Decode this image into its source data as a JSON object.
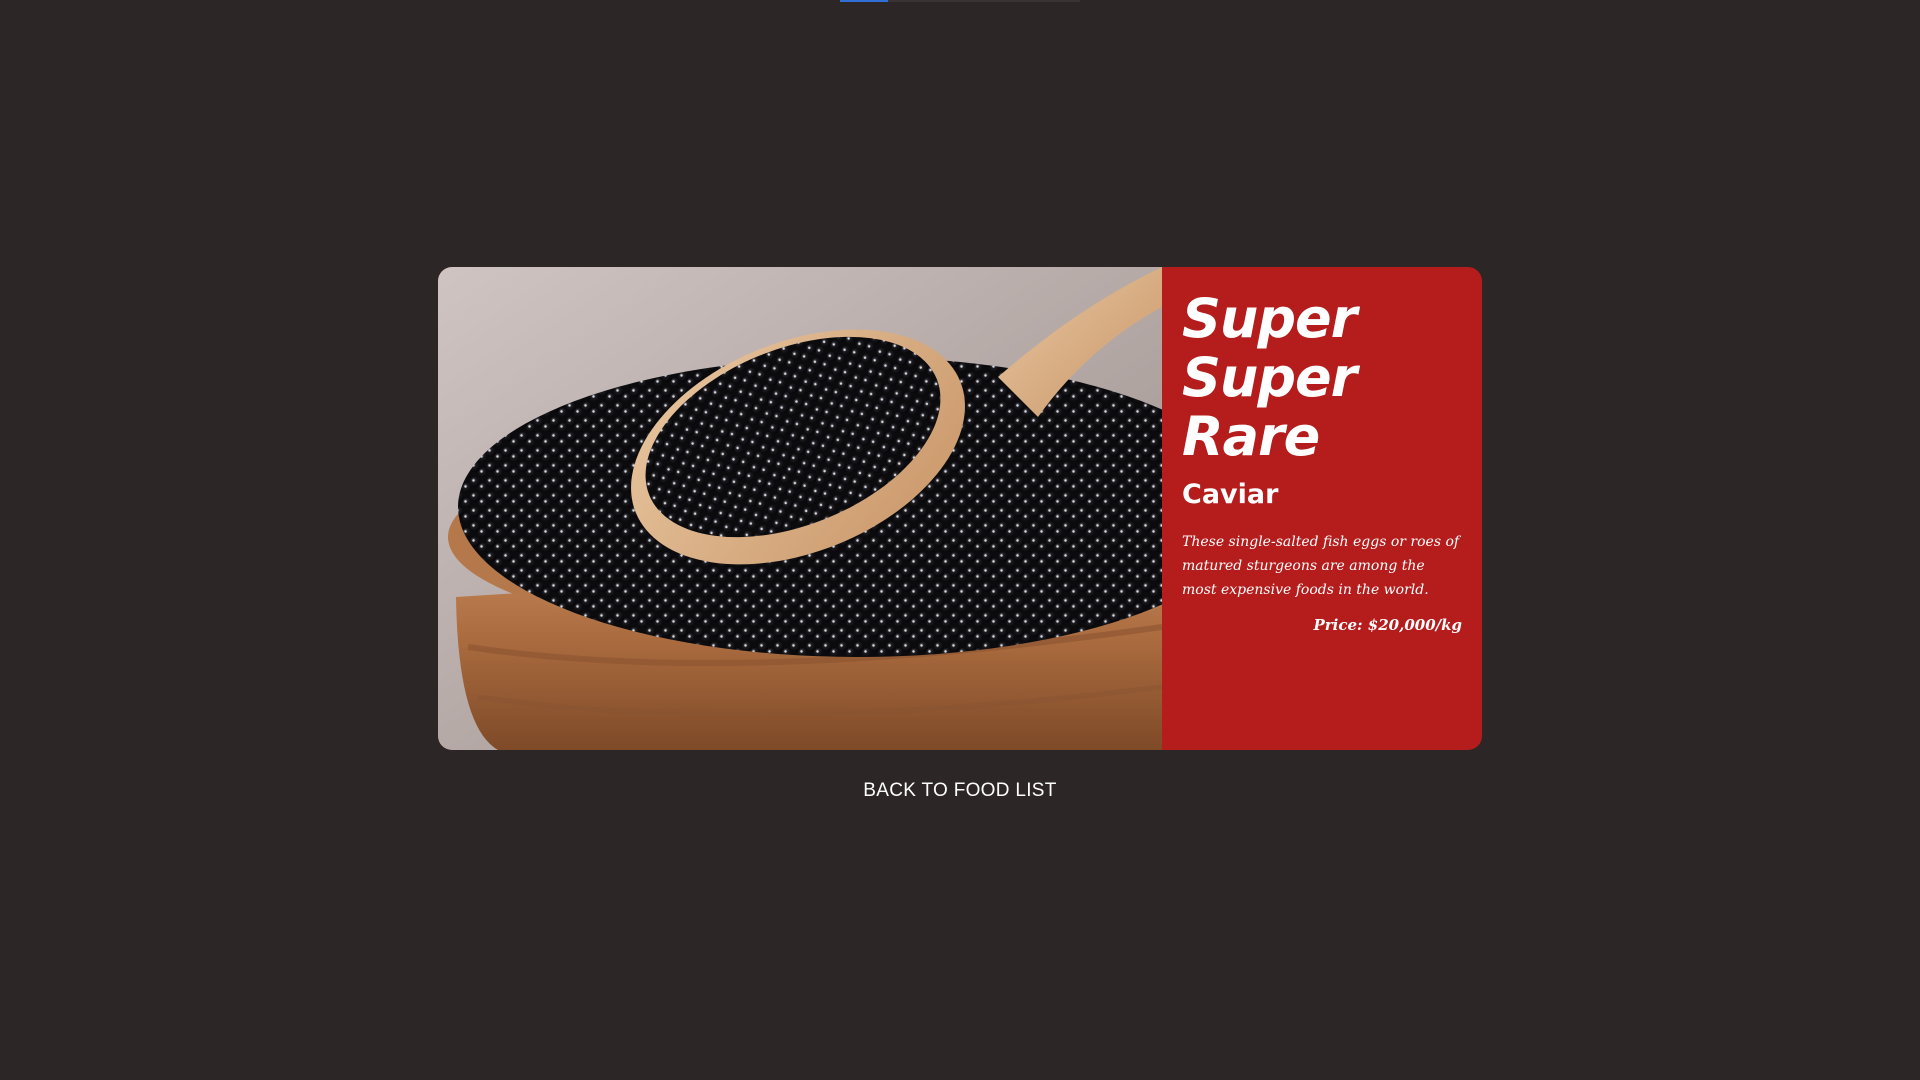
{
  "top_bar": {
    "progress_fraction": 0.2,
    "accent_color": "#2f6fd6"
  },
  "food": {
    "headline": "Super\nSuper\nRare",
    "name": "Caviar",
    "description": "These single-salted fish eggs or roes of matured sturgeons are among the most expensive foods in the world.",
    "price": "Price: $20,000/kg",
    "image_icon": "caviar-spoon-photo",
    "card_color": "#b51c1c"
  },
  "nav": {
    "back_label": "BACK TO FOOD LIST"
  }
}
